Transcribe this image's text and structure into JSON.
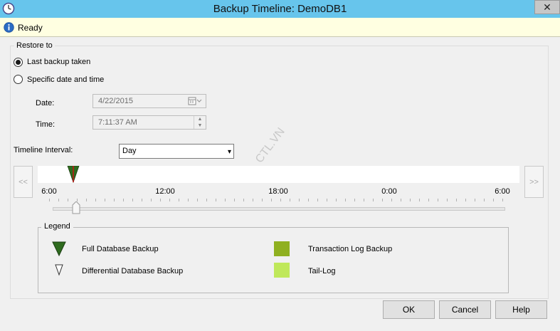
{
  "window": {
    "title": "Backup Timeline: DemoDB1",
    "close_glyph": "✕"
  },
  "status": {
    "text": "Ready"
  },
  "restore_to": {
    "group_label": "Restore to",
    "options": [
      {
        "label": "Last backup taken",
        "checked": true
      },
      {
        "label": "Specific date and time",
        "checked": false
      }
    ],
    "date_label": "Date:",
    "date_value": "4/22/2015",
    "time_label": "Time:",
    "time_value": "7:11:37 AM"
  },
  "timeline": {
    "interval_label": "Timeline Interval:",
    "interval_value": "Day",
    "prev_label": "<<",
    "next_label": ">>",
    "tick_labels": [
      "6:00",
      "12:00",
      "18:00",
      "0:00",
      "6:00"
    ],
    "watermark": "CTL.VN"
  },
  "legend": {
    "title": "Legend",
    "items": [
      {
        "label": "Full Database Backup",
        "icon": "full-backup-triangle-icon",
        "color": "#2e6b1e"
      },
      {
        "label": "Differential Database Backup",
        "icon": "differential-backup-triangle-icon",
        "color": "#ffffff"
      },
      {
        "label": "Transaction Log Backup",
        "icon": "transaction-log-swatch",
        "color": "#8fb020"
      },
      {
        "label": "Tail-Log",
        "icon": "tail-log-swatch",
        "color": "#bfe85a"
      }
    ]
  },
  "buttons": {
    "ok": "OK",
    "cancel": "Cancel",
    "help": "Help"
  },
  "colors": {
    "titlebar": "#67c5ec",
    "statusbar": "#ffffe1",
    "full_backup_marker": "#2e6b1e",
    "marker_line": "#c01818"
  }
}
